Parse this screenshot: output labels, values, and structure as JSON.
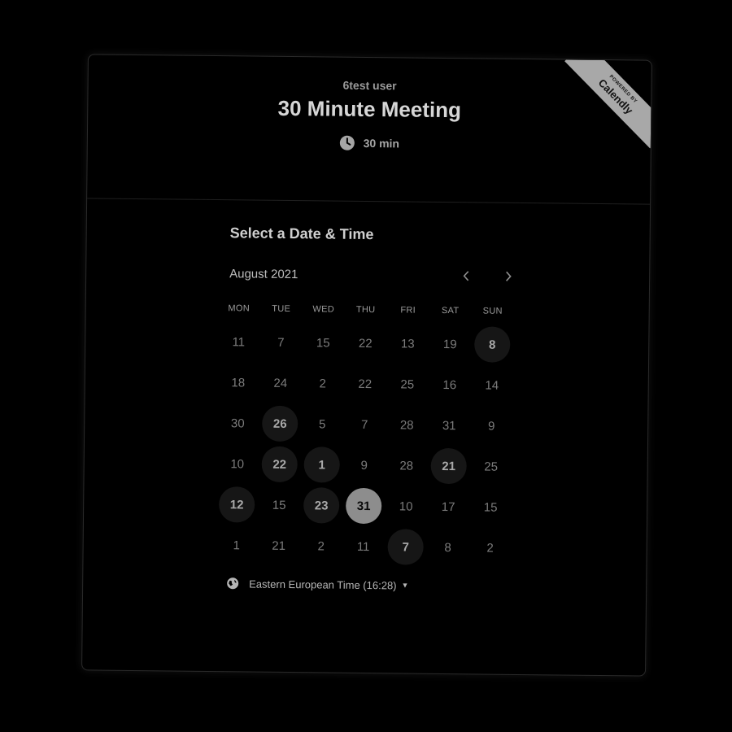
{
  "header": {
    "host_name": "6test user",
    "event_title": "30 Minute Meeting",
    "duration": "30 min"
  },
  "ribbon": {
    "top_text": "POWERED BY",
    "brand": "Calendly"
  },
  "calendar": {
    "section_title": "Select a Date & Time",
    "month_label": "August 2021",
    "prev_icon": "chevron-left-icon",
    "next_icon": "chevron-right-icon",
    "weekdays": [
      "MON",
      "TUE",
      "WED",
      "THU",
      "FRI",
      "SAT",
      "SUN"
    ],
    "rows": [
      [
        {
          "d": "11",
          "s": "off"
        },
        {
          "d": "7",
          "s": "off"
        },
        {
          "d": "15",
          "s": "off"
        },
        {
          "d": "22",
          "s": "off"
        },
        {
          "d": "13",
          "s": "off"
        },
        {
          "d": "19",
          "s": "off"
        },
        {
          "d": "8",
          "s": "available"
        }
      ],
      [
        {
          "d": "18",
          "s": "off"
        },
        {
          "d": "24",
          "s": "off"
        },
        {
          "d": "2",
          "s": "off"
        },
        {
          "d": "22",
          "s": "off"
        },
        {
          "d": "25",
          "s": "off"
        },
        {
          "d": "16",
          "s": "off"
        },
        {
          "d": "14",
          "s": "off"
        }
      ],
      [
        {
          "d": "30",
          "s": "off"
        },
        {
          "d": "26",
          "s": "available"
        },
        {
          "d": "5",
          "s": "off"
        },
        {
          "d": "7",
          "s": "off"
        },
        {
          "d": "28",
          "s": "off"
        },
        {
          "d": "31",
          "s": "off"
        },
        {
          "d": "9",
          "s": "off"
        }
      ],
      [
        {
          "d": "10",
          "s": "off"
        },
        {
          "d": "22",
          "s": "available"
        },
        {
          "d": "1",
          "s": "available"
        },
        {
          "d": "9",
          "s": "off"
        },
        {
          "d": "28",
          "s": "off"
        },
        {
          "d": "21",
          "s": "available"
        },
        {
          "d": "25",
          "s": "off"
        }
      ],
      [
        {
          "d": "12",
          "s": "available"
        },
        {
          "d": "15",
          "s": "off"
        },
        {
          "d": "23",
          "s": "available"
        },
        {
          "d": "31",
          "s": "selected"
        },
        {
          "d": "10",
          "s": "off"
        },
        {
          "d": "17",
          "s": "off"
        },
        {
          "d": "15",
          "s": "off"
        }
      ],
      [
        {
          "d": "1",
          "s": "off"
        },
        {
          "d": "21",
          "s": "off"
        },
        {
          "d": "2",
          "s": "off"
        },
        {
          "d": "11",
          "s": "off"
        },
        {
          "d": "7",
          "s": "available"
        },
        {
          "d": "8",
          "s": "off"
        },
        {
          "d": "2",
          "s": "off"
        }
      ]
    ]
  },
  "timezone": {
    "label": "Eastern European Time (16:28)",
    "icon": "globe-icon",
    "dropdown_icon": "caret-down-icon"
  },
  "colors": {
    "background": "#000000",
    "selected_day": "#8d8d8d",
    "available_day": "#161616",
    "ribbon": "#a8a8a8"
  }
}
